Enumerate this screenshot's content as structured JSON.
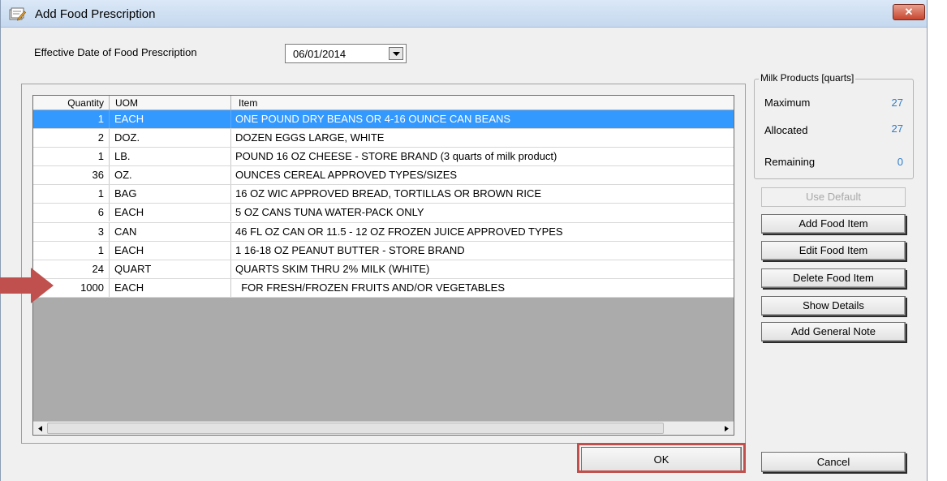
{
  "window": {
    "title": "Add Food Prescription",
    "close_label": "✕"
  },
  "date": {
    "label": "Effective Date of Food Prescription",
    "value": "06/01/2014"
  },
  "grid": {
    "headers": [
      "Quantity",
      "UOM",
      "Item"
    ],
    "selected_row": 0,
    "rows": [
      {
        "quantity": "1",
        "uom": "EACH",
        "item": "ONE POUND DRY BEANS OR 4-16 OUNCE CAN BEANS"
      },
      {
        "quantity": "2",
        "uom": "DOZ.",
        "item": "DOZEN EGGS LARGE, WHITE"
      },
      {
        "quantity": "1",
        "uom": "LB.",
        "item": "POUND 16 OZ CHEESE - STORE BRAND (3 quarts of milk product)"
      },
      {
        "quantity": "36",
        "uom": "OZ.",
        "item": "OUNCES CEREAL APPROVED TYPES/SIZES"
      },
      {
        "quantity": "1",
        "uom": "BAG",
        "item": "16 OZ WIC APPROVED BREAD, TORTILLAS OR BROWN RICE"
      },
      {
        "quantity": "6",
        "uom": "EACH",
        "item": "5 OZ CANS TUNA WATER-PACK ONLY"
      },
      {
        "quantity": "3",
        "uom": "CAN",
        "item": "46  FL OZ CAN OR 11.5 - 12 OZ FROZEN JUICE APPROVED TYPES"
      },
      {
        "quantity": "1",
        "uom": "EACH",
        "item": "1 16-18 OZ PEANUT BUTTER - STORE BRAND"
      },
      {
        "quantity": "24",
        "uom": "QUART",
        "item": "QUARTS SKIM THRU 2% MILK (WHITE)"
      },
      {
        "quantity": "1000",
        "uom": "EACH",
        "item": "  FOR FRESH/FROZEN FRUITS AND/OR VEGETABLES"
      }
    ]
  },
  "milk": {
    "legend": "Milk Products [quarts]",
    "maximum_label": "Maximum",
    "maximum_value": "27",
    "allocated_label": "Allocated",
    "allocated_value": "27",
    "remaining_label": "Remaining",
    "remaining_value": "0"
  },
  "buttons": {
    "use_default": "Use Default",
    "add_food_item": "Add Food Item",
    "edit_food_item": "Edit Food Item",
    "delete_food_item": "Delete Food Item",
    "show_details": "Show Details",
    "add_general_note": "Add General Note",
    "ok": "OK",
    "cancel": "Cancel"
  },
  "colors": {
    "selection": "#3399ff",
    "highlight_box": "#c0504d",
    "arrow": "#c0504d",
    "milk_value": "#2e7cc8"
  },
  "icons": {
    "title": "prescription-edit-icon",
    "close": "close-icon",
    "dropdown": "chevron-down-icon",
    "arrow_marker": "red-arrow-icon"
  }
}
